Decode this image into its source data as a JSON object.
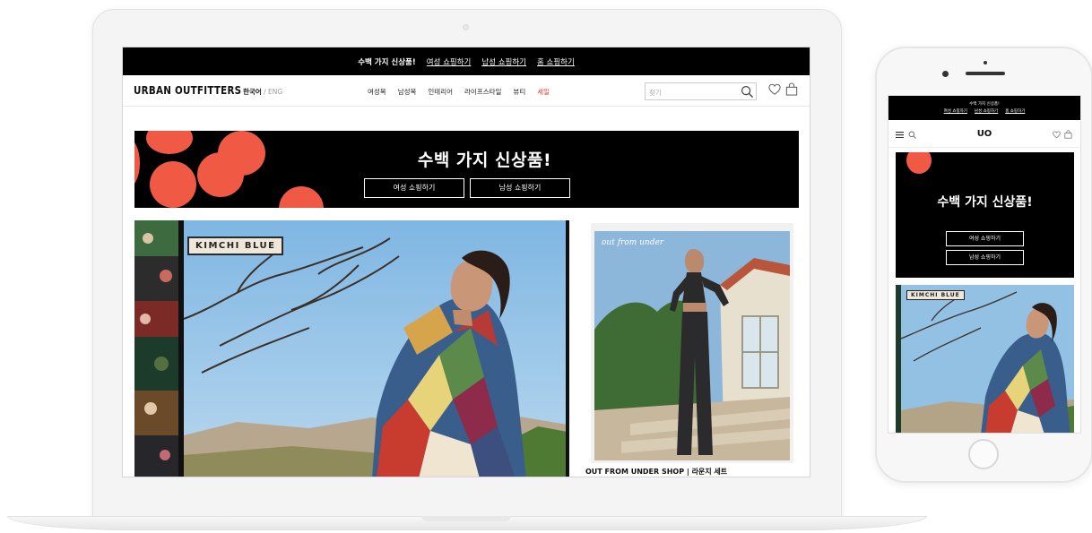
{
  "desktop": {
    "promo_bar": {
      "headline": "수백 가지 신상품!",
      "links": [
        "여성 쇼핑하기",
        "남성 쇼핑하기",
        "홈 쇼핑하기"
      ]
    },
    "nav": {
      "logo": "URBAN OUTFITTERS",
      "lang_current": "한국어",
      "lang_sep": " / ",
      "lang_alt": "ENG",
      "links": [
        "여성복",
        "남성복",
        "인테리어",
        "라이프스타일",
        "뷰티",
        "세일"
      ],
      "search_placeholder": "찾기"
    },
    "hero": {
      "title": "수백 가지 신상품!",
      "buttons": [
        "여성 쇼핑하기",
        "남성 쇼핑하기"
      ]
    },
    "main_photo": {
      "sign": "KIMCHI BLUE"
    },
    "side_photo": {
      "script": "out from under",
      "caption": "OUT FROM UNDER SHOP | 라운지 세트"
    }
  },
  "mobile": {
    "promo_bar": {
      "headline": "수백 가지 신상품!",
      "links": [
        "여성 쇼핑하기",
        "남성 쇼핑하기",
        "홈 쇼핑하기"
      ]
    },
    "nav": {
      "logo": "UO"
    },
    "hero": {
      "title": "수백 가지 신상품!",
      "buttons": [
        "여성 쇼핑하기",
        "남성 쇼핑하기"
      ]
    },
    "photo": {
      "sign": "KIMCHI BLUE"
    }
  },
  "colors": {
    "sale": "#e23b2e",
    "hero_dot": "#f05a44",
    "promo_bg": "#000000"
  },
  "icons": [
    "search-icon",
    "heart-icon",
    "bag-icon",
    "hamburger-menu-icon"
  ]
}
